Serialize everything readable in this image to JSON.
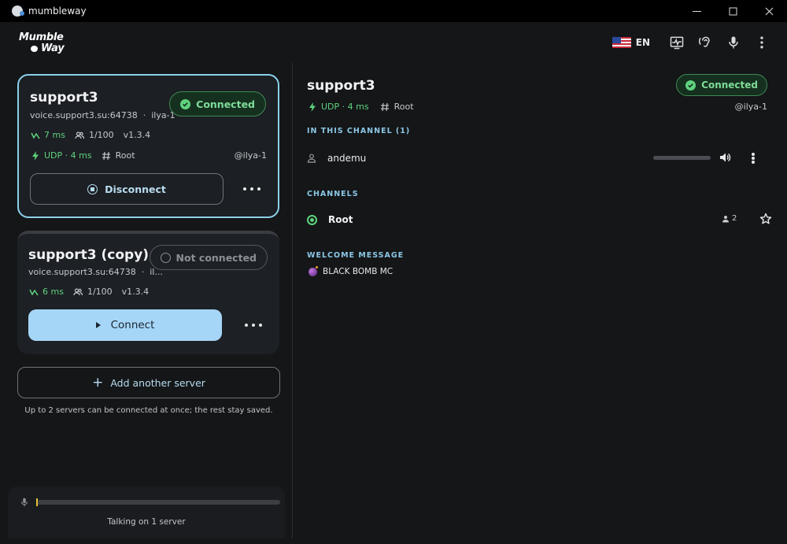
{
  "window": {
    "title": "mumbleway"
  },
  "header": {
    "logo_line1": "Mumble",
    "logo_line2": "Way",
    "language": "EN",
    "icons": [
      "flag-us-icon",
      "monitor-wave-icon",
      "hearing-icon",
      "microphone-icon",
      "more-vert-icon"
    ]
  },
  "servers": [
    {
      "name": "support3",
      "host": "voice.support3.su:64738",
      "user_short": "ilya-1",
      "status": "Connected",
      "ping": "7 ms",
      "users": "1/100",
      "version": "v1.3.4",
      "transport": "UDP · 4 ms",
      "channel": "Root",
      "user": "@ilya-1",
      "action": "Disconnect"
    },
    {
      "name": "support3 (copy)",
      "host": "voice.support3.su:64738",
      "user_short": "il...",
      "status": "Not connected",
      "ping": "6 ms",
      "users": "1/100",
      "version": "v1.3.4",
      "action": "Connect"
    }
  ],
  "add_server": "Add another server",
  "hint": "Up to 2 servers can be connected at once; the rest stay saved.",
  "talk": {
    "label": "Talking on 1 server",
    "level": 0.0
  },
  "detail": {
    "title": "support3",
    "status": "Connected",
    "transport": "UDP · 4 ms",
    "channel": "Root",
    "user": "@ilya-1",
    "in_channel_label": "IN THIS CHANNEL (1)",
    "members": [
      {
        "name": "andemu"
      }
    ],
    "channels_label": "CHANNELS",
    "channels": [
      {
        "name": "Root",
        "count": "2"
      }
    ],
    "welcome_label": "WELCOME MESSAGE",
    "welcome_text": "BLACK BOMB MC"
  },
  "colors": {
    "accent": "#8cd0ea",
    "connected": "#5fd27e",
    "primary_button": "#a6d6f7",
    "background": "#141618"
  }
}
